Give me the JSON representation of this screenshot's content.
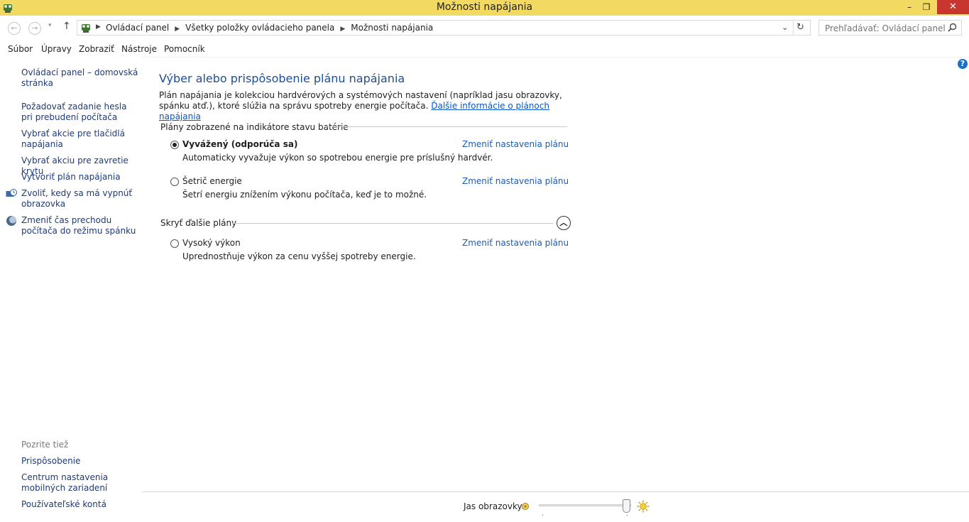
{
  "window": {
    "title": "Možnosti napájania",
    "controls": {
      "minimize": "–",
      "restore": "❐",
      "close": "✕"
    }
  },
  "address": {
    "crumbs": [
      "Ovládací panel",
      "Všetky položky ovládacieho panela",
      "Možnosti napájania"
    ],
    "search_placeholder": "Prehľadávať: Ovládací panel"
  },
  "menu": [
    "Súbor",
    "Úpravy",
    "Zobraziť",
    "Nástroje",
    "Pomocník"
  ],
  "sidebar": {
    "home": "Ovládací panel – domovská stránka",
    "items": [
      "Požadovať zadanie hesla pri prebudení počítača",
      "Vybrať akcie pre tlačidlá napájania",
      "Vybrať akciu pre zavretie krytu",
      "Vytvoriť plán napájania",
      "Zvoliť, kedy sa má vypnúť obrazovka",
      "Zmeniť čas prechodu počítača do režimu spánku"
    ],
    "see_also_label": "Pozrite tiež",
    "see_also": [
      "Prispôsobenie",
      "Centrum nastavenia mobilných zariadení",
      "Používateľské kontá"
    ]
  },
  "main": {
    "heading": "Výber alebo prispôsobenie plánu napájania",
    "description": "Plán napájania je kolekciou hardvérových a systémových nastavení (napríklad jasu obrazovky, spánku atď.), ktoré slúžia na správu spotreby energie počítača.",
    "more_info_link": "Ďalšie informácie o plánoch napájania",
    "section_plans": "Plány zobrazené na indikátore stavu batérie",
    "section_hidden": "Skryť ďalšie plány",
    "change_link": "Zmeniť nastavenia plánu",
    "plans": [
      {
        "name": "Vyvážený (odporúča sa)",
        "desc": "Automaticky vyvažuje výkon so spotrebou energie pre príslušný hardvér.",
        "selected": true
      },
      {
        "name": "Šetrič energie",
        "desc": "Šetrí energiu znížením výkonu počítača, keď je to možné.",
        "selected": false
      },
      {
        "name": "Vysoký výkon",
        "desc": "Uprednostňuje výkon za cenu vyššej spotreby energie.",
        "selected": false
      }
    ]
  },
  "brightness": {
    "label": "Jas obrazovky:",
    "level_percent": 100
  },
  "colors": {
    "titlebar": "#f2d962",
    "close": "#c7372f",
    "heading": "#1e4e96",
    "link": "#0b55c5"
  }
}
